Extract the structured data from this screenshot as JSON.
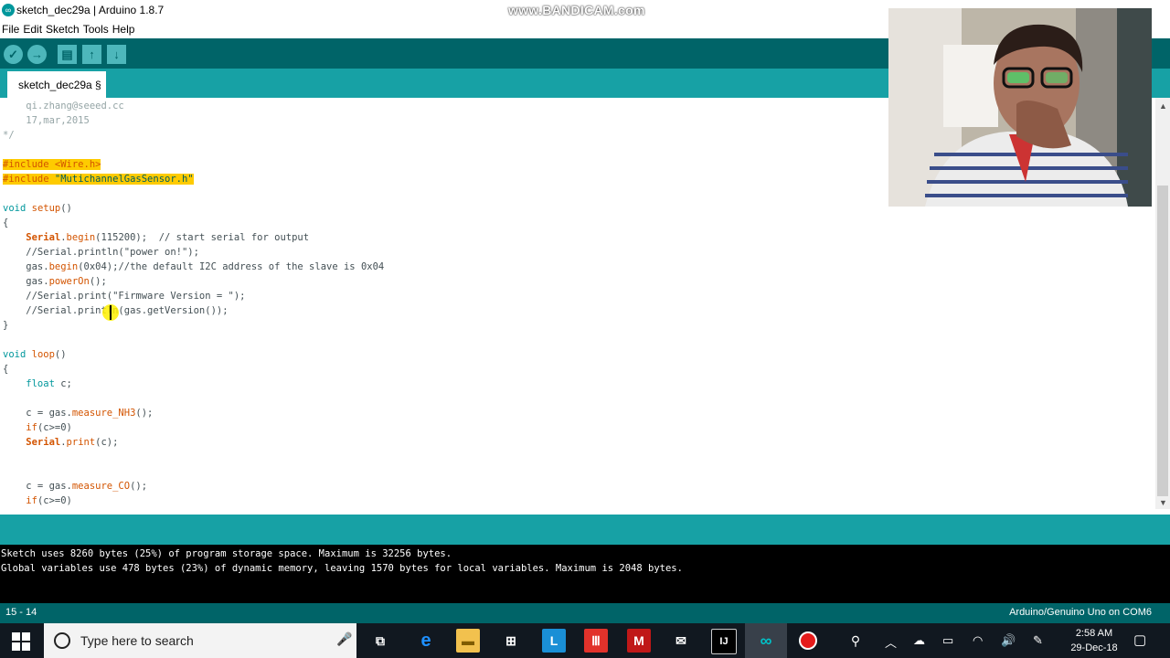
{
  "window": {
    "title": "sketch_dec29a | Arduino 1.8.7",
    "watermark": "www.BANDICAM.com"
  },
  "menu": [
    "File",
    "Edit",
    "Sketch",
    "Tools",
    "Help"
  ],
  "toolbar": {
    "verify": "✓",
    "upload": "→",
    "new": "▤",
    "open": "↑",
    "save": "↓"
  },
  "tab": {
    "label": "sketch_dec29a §"
  },
  "code": {
    "l1": "    qi.zhang@seeed.cc",
    "l2": "    17,mar,2015",
    "l3": "*/",
    "inc1": "#include <Wire.h>",
    "inc2_kw": "#include ",
    "inc2_str": "\"MutichannelGasSensor.h\"",
    "setup_void": "void",
    "setup_name": " setup",
    "setup_rest": "()",
    "brace_open": "{",
    "brace_close": "}",
    "s1_obj": "    Serial",
    "s1_dot": ".",
    "s1_fn": "begin",
    "s1_rest": "(115200);  // start serial for output",
    "s2": "    //Serial.println(\"power on!\");",
    "s3_pre": "    gas.",
    "s3_fn": "begin",
    "s3_rest": "(0x04);//the default I2C address of the slave is 0x04",
    "s4_pre": "    gas.",
    "s4_fn": "powerOn",
    "s4_rest": "();",
    "s5": "    //Serial.print(\"Firmware Version = \");",
    "s6": "    //Serial.println(gas.getVersion());",
    "loop_void": "void",
    "loop_name": " loop",
    "loop_rest": "()",
    "f1_type": "    float",
    "f1_rest": " c;",
    "m1_pre": "    c = gas.",
    "m1_fn": "measure_NH3",
    "m1_rest": "();",
    "if1_kw": "    if",
    "if1_rest": "(c>=0)",
    "p1_obj": "    Serial",
    "p1_dot": ".",
    "p1_fn": "print",
    "p1_rest": "(c);",
    "m2_pre": "    c = gas.",
    "m2_fn": "measure_CO",
    "m2_rest": "();",
    "if2_kw": "    if",
    "if2_rest": "(c>=0)"
  },
  "console": {
    "line1": "Sketch uses 8260 bytes (25%) of program storage space. Maximum is 32256 bytes.",
    "line2": "Global variables use 478 bytes (23%) of dynamic memory, leaving 1570 bytes for local variables. Maximum is 2048 bytes."
  },
  "footer": {
    "position": "15 - 14",
    "board": "Arduino/Genuino Uno on COM6"
  },
  "taskbar": {
    "search_placeholder": "Type here to search",
    "time": "2:58 AM",
    "date": "29-Dec-18"
  },
  "colors": {
    "toolbar": "#006468",
    "tabstrip": "#17a1a5",
    "highlight": "#fecb00",
    "taskbar": "#111820"
  }
}
